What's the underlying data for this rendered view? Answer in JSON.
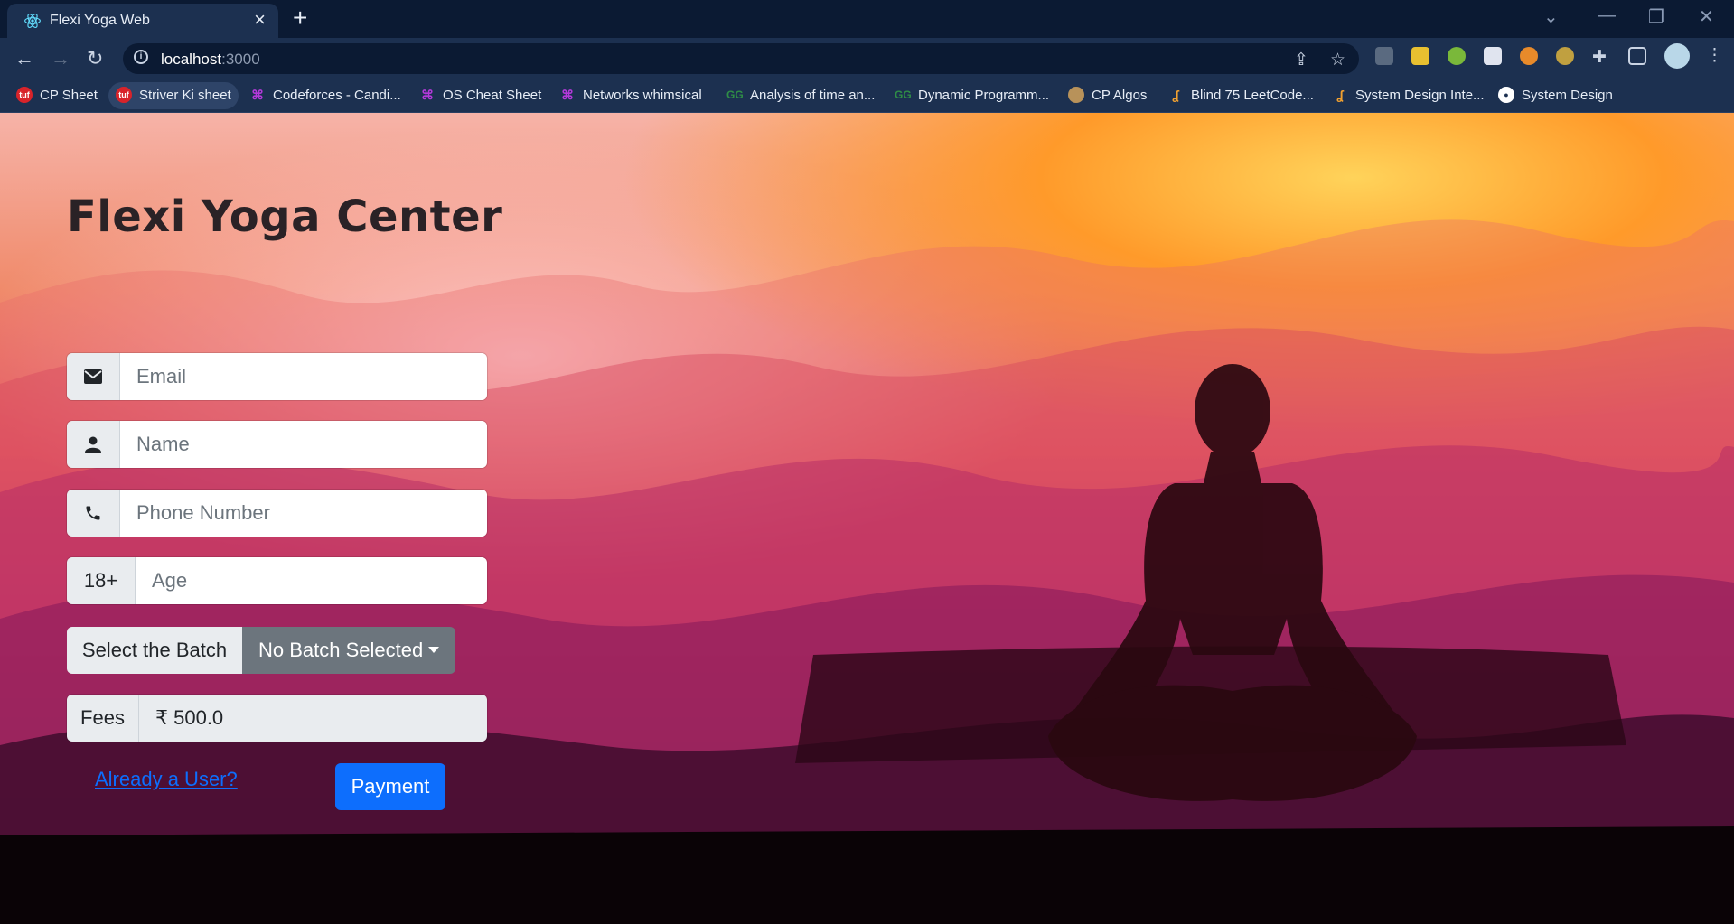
{
  "browser": {
    "tab_title": "Flexi Yoga Web",
    "url_host": "localhost",
    "url_port": ":3000",
    "bookmarks": [
      {
        "label": "CP Sheet",
        "icon": "tuf-icon",
        "color": "#d8232a"
      },
      {
        "label": "Striver Ki sheet",
        "icon": "tuf-icon",
        "color": "#d8232a"
      },
      {
        "label": "Codeforces - Candi...",
        "icon": "whimsical-icon",
        "color": "#b339d9"
      },
      {
        "label": "OS Cheat Sheet",
        "icon": "whimsical-icon",
        "color": "#b339d9"
      },
      {
        "label": "Networks whimsical",
        "icon": "whimsical-icon",
        "color": "#b339d9"
      },
      {
        "label": "Analysis of time an...",
        "icon": "gfg-icon",
        "color": "#2f8d46"
      },
      {
        "label": "Dynamic Programm...",
        "icon": "gfg-icon",
        "color": "#2f8d46"
      },
      {
        "label": "CP Algos",
        "icon": "cpalgos-icon",
        "color": "#b8925a"
      },
      {
        "label": "Blind 75 LeetCode...",
        "icon": "leetcode-icon",
        "color": "#f0a030"
      },
      {
        "label": "System Design Inte...",
        "icon": "leetcode-icon",
        "color": "#f0a030"
      },
      {
        "label": "System Design",
        "icon": "github-icon",
        "color": "#ffffff"
      }
    ]
  },
  "page": {
    "heading": "Flexi Yoga Center",
    "email_placeholder": "Email",
    "name_placeholder": "Name",
    "phone_placeholder": "Phone Number",
    "age_addon": "18+",
    "age_placeholder": "Age",
    "batch_label": "Select the Batch",
    "batch_selected": "No Batch Selected",
    "fees_label": "Fees",
    "fees_value": "₹ 500.0",
    "login_link": "Already a User?",
    "payment_button": "Payment"
  },
  "colors": {
    "primary": "#0d6efd",
    "secondary": "#6c757d",
    "addon_bg": "#e9ecef"
  }
}
